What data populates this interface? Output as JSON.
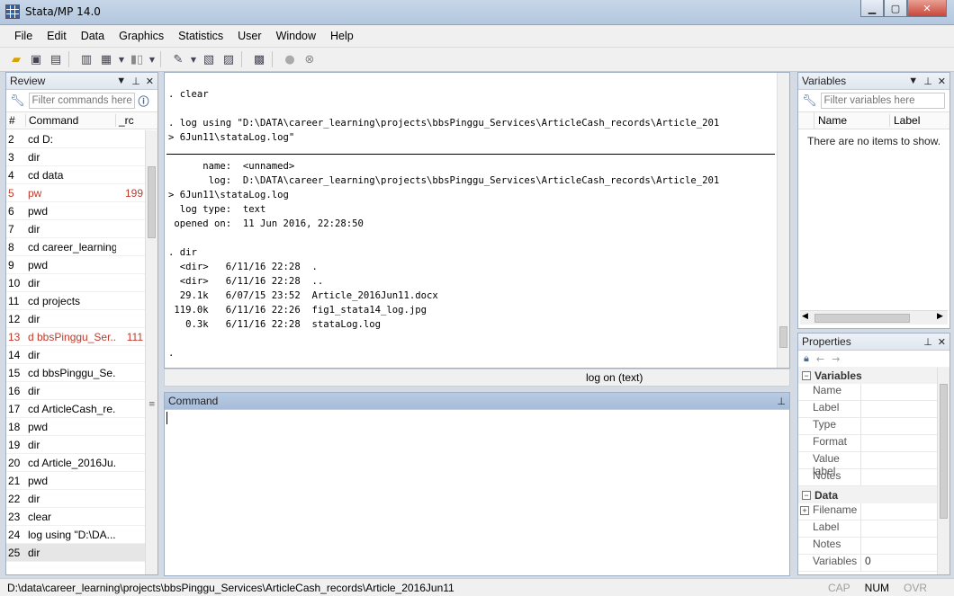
{
  "window": {
    "title": "Stata/MP 14.0",
    "min_icon": "minimize-icon",
    "max_icon": "maximize-icon",
    "close_icon": "close-icon"
  },
  "menu": [
    "File",
    "Edit",
    "Data",
    "Graphics",
    "Statistics",
    "User",
    "Window",
    "Help"
  ],
  "review": {
    "title": "Review",
    "filter_placeholder": "Filter commands here",
    "col_num": "#",
    "col_command": "Command",
    "col_rc": "_rc",
    "rows": [
      {
        "n": "2",
        "cmd": "cd D:",
        "rc": ""
      },
      {
        "n": "3",
        "cmd": "dir",
        "rc": ""
      },
      {
        "n": "4",
        "cmd": "cd data",
        "rc": ""
      },
      {
        "n": "5",
        "cmd": "pw",
        "rc": "199"
      },
      {
        "n": "6",
        "cmd": "pwd",
        "rc": ""
      },
      {
        "n": "7",
        "cmd": "dir",
        "rc": ""
      },
      {
        "n": "8",
        "cmd": "cd career_learning",
        "rc": ""
      },
      {
        "n": "9",
        "cmd": "pwd",
        "rc": ""
      },
      {
        "n": "10",
        "cmd": "dir",
        "rc": ""
      },
      {
        "n": "11",
        "cmd": "cd projects",
        "rc": ""
      },
      {
        "n": "12",
        "cmd": "dir",
        "rc": ""
      },
      {
        "n": "13",
        "cmd": "d bbsPinggu_Ser...",
        "rc": "111"
      },
      {
        "n": "14",
        "cmd": "dir",
        "rc": ""
      },
      {
        "n": "15",
        "cmd": "cd bbsPinggu_Se...",
        "rc": ""
      },
      {
        "n": "16",
        "cmd": "dir",
        "rc": ""
      },
      {
        "n": "17",
        "cmd": "cd ArticleCash_re...",
        "rc": ""
      },
      {
        "n": "18",
        "cmd": "pwd",
        "rc": ""
      },
      {
        "n": "19",
        "cmd": "dir",
        "rc": ""
      },
      {
        "n": "20",
        "cmd": "cd Article_2016Ju...",
        "rc": ""
      },
      {
        "n": "21",
        "cmd": "pwd",
        "rc": ""
      },
      {
        "n": "22",
        "cmd": "dir",
        "rc": ""
      },
      {
        "n": "23",
        "cmd": "clear",
        "rc": ""
      },
      {
        "n": "24",
        "cmd": "log using \"D:\\DA...",
        "rc": ""
      },
      {
        "n": "25",
        "cmd": "dir",
        "rc": ""
      }
    ]
  },
  "results": {
    "lines_top": ". clear\n\n. log using \"D:\\DATA\\career_learning\\projects\\bbsPinggu_Services\\ArticleCash_records\\Article_201\n> 6Jun11\\stataLog.log\"",
    "lines_bottom": "      name:  <unnamed>\n       log:  D:\\DATA\\career_learning\\projects\\bbsPinggu_Services\\ArticleCash_records\\Article_201\n> 6Jun11\\stataLog.log\n  log type:  text\n opened on:  11 Jun 2016, 22:28:50\n\n. dir\n  <dir>   6/11/16 22:28  .\n  <dir>   6/11/16 22:28  ..\n  29.1k   6/07/15 23:52  Article_2016Jun11.docx\n 119.0k   6/11/16 22:26  fig1_stata14_log.jpg\n   0.3k   6/11/16 22:28  stataLog.log\n\n."
  },
  "status_log": "log on (text)",
  "command": {
    "title": "Command"
  },
  "variables": {
    "title": "Variables",
    "filter_placeholder": "Filter variables here",
    "col_name": "Name",
    "col_label": "Label",
    "empty": "There are no items to show."
  },
  "properties": {
    "title": "Properties",
    "section_variables": "Variables",
    "var_fields": [
      "Name",
      "Label",
      "Type",
      "Format",
      "Value label",
      "Notes"
    ],
    "section_data": "Data",
    "data_fields": [
      {
        "k": "Filename",
        "v": ""
      },
      {
        "k": "Label",
        "v": ""
      },
      {
        "k": "Notes",
        "v": ""
      },
      {
        "k": "Variables",
        "v": "0"
      }
    ]
  },
  "statusbar": {
    "path": "D:\\data\\career_learning\\projects\\bbsPinggu_Services\\ArticleCash_records\\Article_2016Jun11",
    "cap": "CAP",
    "num": "NUM",
    "ovr": "OVR"
  },
  "colors": {
    "error_row": "#c0392b",
    "command_header": "#a6bcd9"
  }
}
